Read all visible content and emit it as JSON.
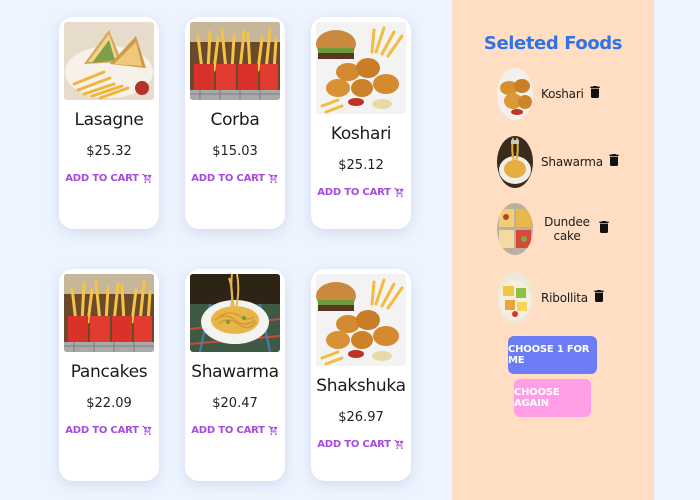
{
  "foods": [
    {
      "name": "Lasagne",
      "price": "$25.32",
      "add_label": "ADD TO CART",
      "image": "sandwich-fries"
    },
    {
      "name": "Corba",
      "price": "$15.03",
      "add_label": "ADD TO CART",
      "image": "fries-basket"
    },
    {
      "name": "Koshari",
      "price": "$25.12",
      "add_label": "ADD TO CART",
      "image": "burger-nuggets"
    },
    {
      "name": "Pancakes",
      "price": "$22.09",
      "add_label": "ADD TO CART",
      "image": "fries-basket"
    },
    {
      "name": "Shawarma",
      "price": "$20.47",
      "add_label": "ADD TO CART",
      "image": "noodles-plate"
    },
    {
      "name": "Shakshuka",
      "price": "$26.97",
      "add_label": "ADD TO CART",
      "image": "burger-nuggets"
    }
  ],
  "selected": {
    "title": "Seleted Foods",
    "items": [
      {
        "name": "Koshari",
        "image": "nuggets"
      },
      {
        "name": "Shawarma",
        "image": "noodles"
      },
      {
        "name": "Dundee cake",
        "image": "cake-tray"
      },
      {
        "name": "Ribollita",
        "image": "fruit-bowl"
      }
    ]
  },
  "buttons": {
    "choose": "CHOOSE 1 FOR ME",
    "again": "CHOOSE AGAIN"
  },
  "colors": {
    "background": "#eef4ff",
    "panel": "#ffdec4",
    "title": "#2f73e6",
    "add_to_cart": "#a64bdc",
    "choose_button": "#6b7cf4",
    "again_button": "#ff9ee6"
  },
  "icons": {
    "cart": "cart-icon",
    "delete": "trash-icon"
  }
}
